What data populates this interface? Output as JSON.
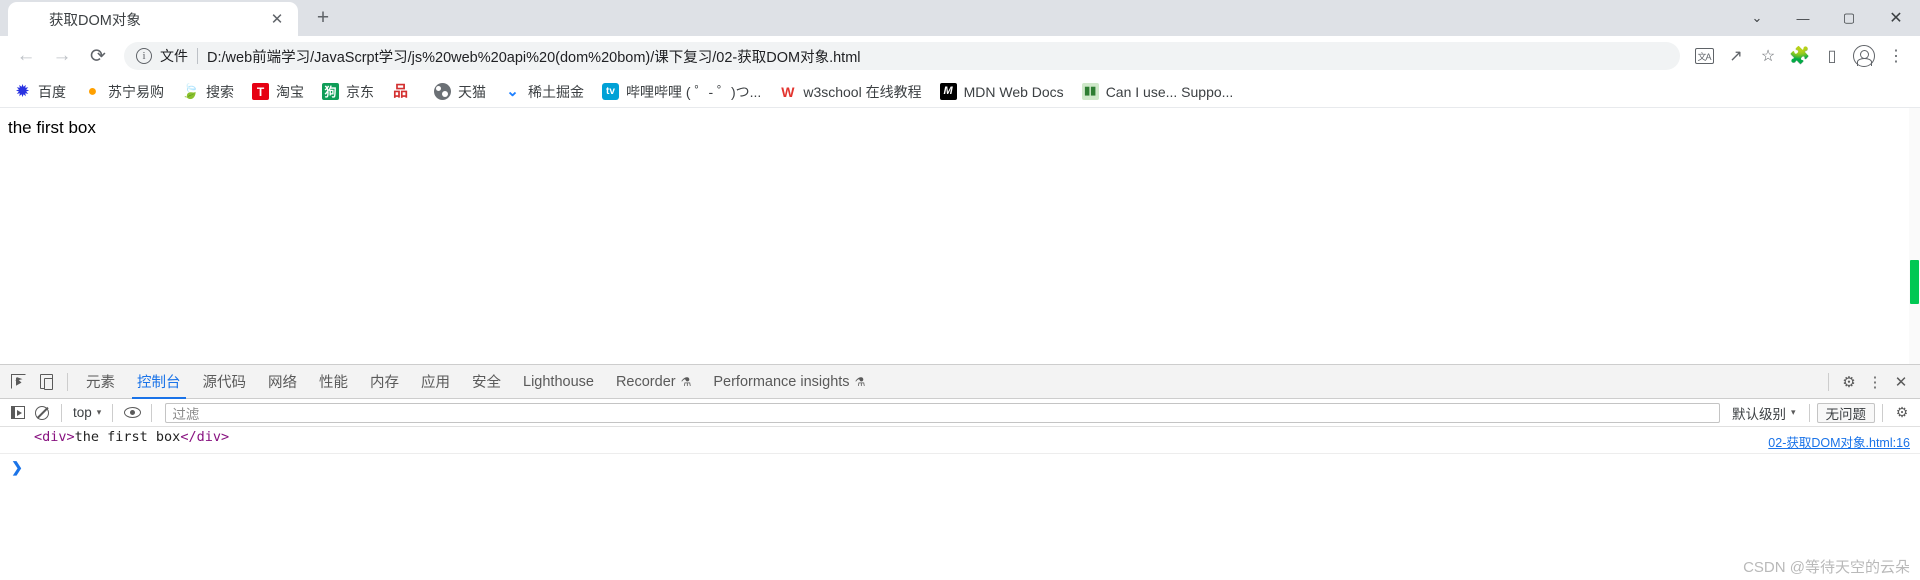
{
  "window": {
    "minimize_label": "—",
    "maximize_label": "▢",
    "close_label": "✕",
    "collapse_label": "⌄"
  },
  "tab": {
    "title": "获取DOM对象",
    "favicon": "globe-icon",
    "close_label": "✕",
    "newtab_label": "+"
  },
  "toolbar": {
    "back_label": "←",
    "forward_label": "→",
    "reload_label": "⟳",
    "info_label": "i",
    "scheme_label": "文件",
    "url": "D:/web前端学习/JavaScrpt学习/js%20web%20api%20(dom%20bom)/课下复习/02-获取DOM对象.html",
    "translate_label": "文A",
    "share_label": "↗",
    "bookmark_star_label": "☆",
    "extensions_label": "🧩",
    "sidepanel_label": "▯",
    "profile_label": "avatar-icon",
    "menu_label": "⋮"
  },
  "bookmarks": [
    {
      "label": "百度",
      "icon": "baidu-paw-icon",
      "glyph": "✹",
      "style": "ico-baidu"
    },
    {
      "label": "苏宁易购",
      "icon": "suning-lion-icon",
      "glyph": "●",
      "style": "ico-suning"
    },
    {
      "label": "搜索",
      "icon": "sogou-icon",
      "glyph": "🍃",
      "style": "ico-sogou"
    },
    {
      "label": "淘宝",
      "icon": "taobao-icon",
      "glyph": "T",
      "style": "ico-taobao"
    },
    {
      "label": "京东",
      "icon": "jd-icon",
      "glyph": "狗",
      "style": "ico-jd"
    },
    {
      "label": "",
      "icon": "pinduoduo-icon",
      "glyph": "品",
      "style": "ico-pin"
    },
    {
      "label": "天猫",
      "icon": "tmall-globe-icon",
      "glyph": "",
      "style": "ico-tmall"
    },
    {
      "label": "稀土掘金",
      "icon": "juejin-icon",
      "glyph": "⌄",
      "style": "ico-juejin"
    },
    {
      "label": "哔哩哔哩 ( ゜- ゜)つ...",
      "icon": "bilibili-icon",
      "glyph": "tv",
      "style": "ico-bili"
    },
    {
      "label": "w3school 在线教程",
      "icon": "w3school-icon",
      "glyph": "W",
      "style": "ico-w3"
    },
    {
      "label": "MDN Web Docs",
      "icon": "mdn-icon",
      "glyph": "M",
      "style": "ico-mdn"
    },
    {
      "label": "Can I use... Suppo...",
      "icon": "caniuse-icon",
      "glyph": "▮▮",
      "style": "ico-caniuse"
    }
  ],
  "page": {
    "content_text": "the first box"
  },
  "devtools": {
    "inspect_icon": "inspect-element-icon",
    "device_icon": "device-toolbar-icon",
    "tabs": [
      {
        "label": "元素",
        "active": false,
        "flask": false
      },
      {
        "label": "控制台",
        "active": true,
        "flask": false
      },
      {
        "label": "源代码",
        "active": false,
        "flask": false
      },
      {
        "label": "网络",
        "active": false,
        "flask": false
      },
      {
        "label": "性能",
        "active": false,
        "flask": false
      },
      {
        "label": "内存",
        "active": false,
        "flask": false
      },
      {
        "label": "应用",
        "active": false,
        "flask": false
      },
      {
        "label": "安全",
        "active": false,
        "flask": false
      },
      {
        "label": "Lighthouse",
        "active": false,
        "flask": false
      },
      {
        "label": "Recorder",
        "active": false,
        "flask": true
      },
      {
        "label": "Performance insights",
        "active": false,
        "flask": true
      }
    ],
    "flask_glyph": "⚗",
    "settings_label": "⚙",
    "more_label": "⋮",
    "close_label": "✕",
    "console": {
      "sidebar_toggle": "console-sidebar-toggle-icon",
      "clear_label": "clear-console-icon",
      "context": "top",
      "context_caret": "▾",
      "eye_label": "live-expression-icon",
      "filter_placeholder": "过滤",
      "filter_value": "",
      "level": "默认级别",
      "level_caret": "▾",
      "issues_label": "无问题",
      "gear_label": "⚙",
      "messages": [
        {
          "open_tag": "<div>",
          "text": "the first box",
          "close_tag": "</div>",
          "source": "02-获取DOM对象.html:16"
        }
      ],
      "prompt_arrow": "❯"
    }
  },
  "watermark": "CSDN @等待天空的云朵",
  "colors": {
    "accent": "#1a73e8",
    "tabstrip_bg": "#dee1e6",
    "devtools_bg": "#f3f3f3",
    "tag_purple": "#881280",
    "scrollbar_green": "#00c853"
  }
}
